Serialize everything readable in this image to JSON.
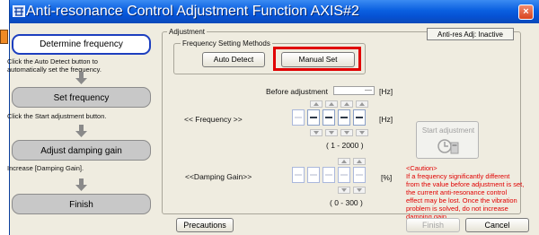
{
  "window": {
    "title": "Anti-resonance Control Adjustment Function AXIS#2",
    "close_label": "×"
  },
  "wizard": {
    "steps": [
      {
        "label": "Determine frequency",
        "note": "Click the Auto Detect button to\nautomatically set the frequency."
      },
      {
        "label": "Set frequency",
        "note": "Click the Start adjustment button."
      },
      {
        "label": "Adjust damping gain",
        "note": "Increase [Damping Gain]."
      },
      {
        "label": "Finish",
        "note": ""
      }
    ]
  },
  "adjustment": {
    "group_label": "Adjustment",
    "status_button": "Anti-res Adj: Inactive",
    "freq_methods_label": "Frequency Setting Methods",
    "auto_detect": "Auto Detect",
    "manual_set": "Manual Set",
    "before_label": "Before adjustment",
    "before_value": "----",
    "hz": "[Hz]",
    "freq_label": "<< Frequency >>",
    "freq_range": "( 1 - 2000 )",
    "gain_label": "<<Damping Gain>>",
    "percent": "[%]",
    "gain_range": "( 0 - 300 )",
    "start_button": "Start adjustment",
    "caution": "<Caution>\nIf a frequency significantly different from the value before adjustment is set, the current anti-resonance control effect may be lost. Once the vibration problem is solved, do not increase damping gain."
  },
  "footer": {
    "precautions": "Precautions",
    "finish": "Finish",
    "cancel": "Cancel"
  },
  "colors": {
    "title_bar": "#0a5fe0",
    "active_step_border": "#1d3fbf",
    "highlight": "#e00000",
    "caution_text": "#e00000"
  }
}
